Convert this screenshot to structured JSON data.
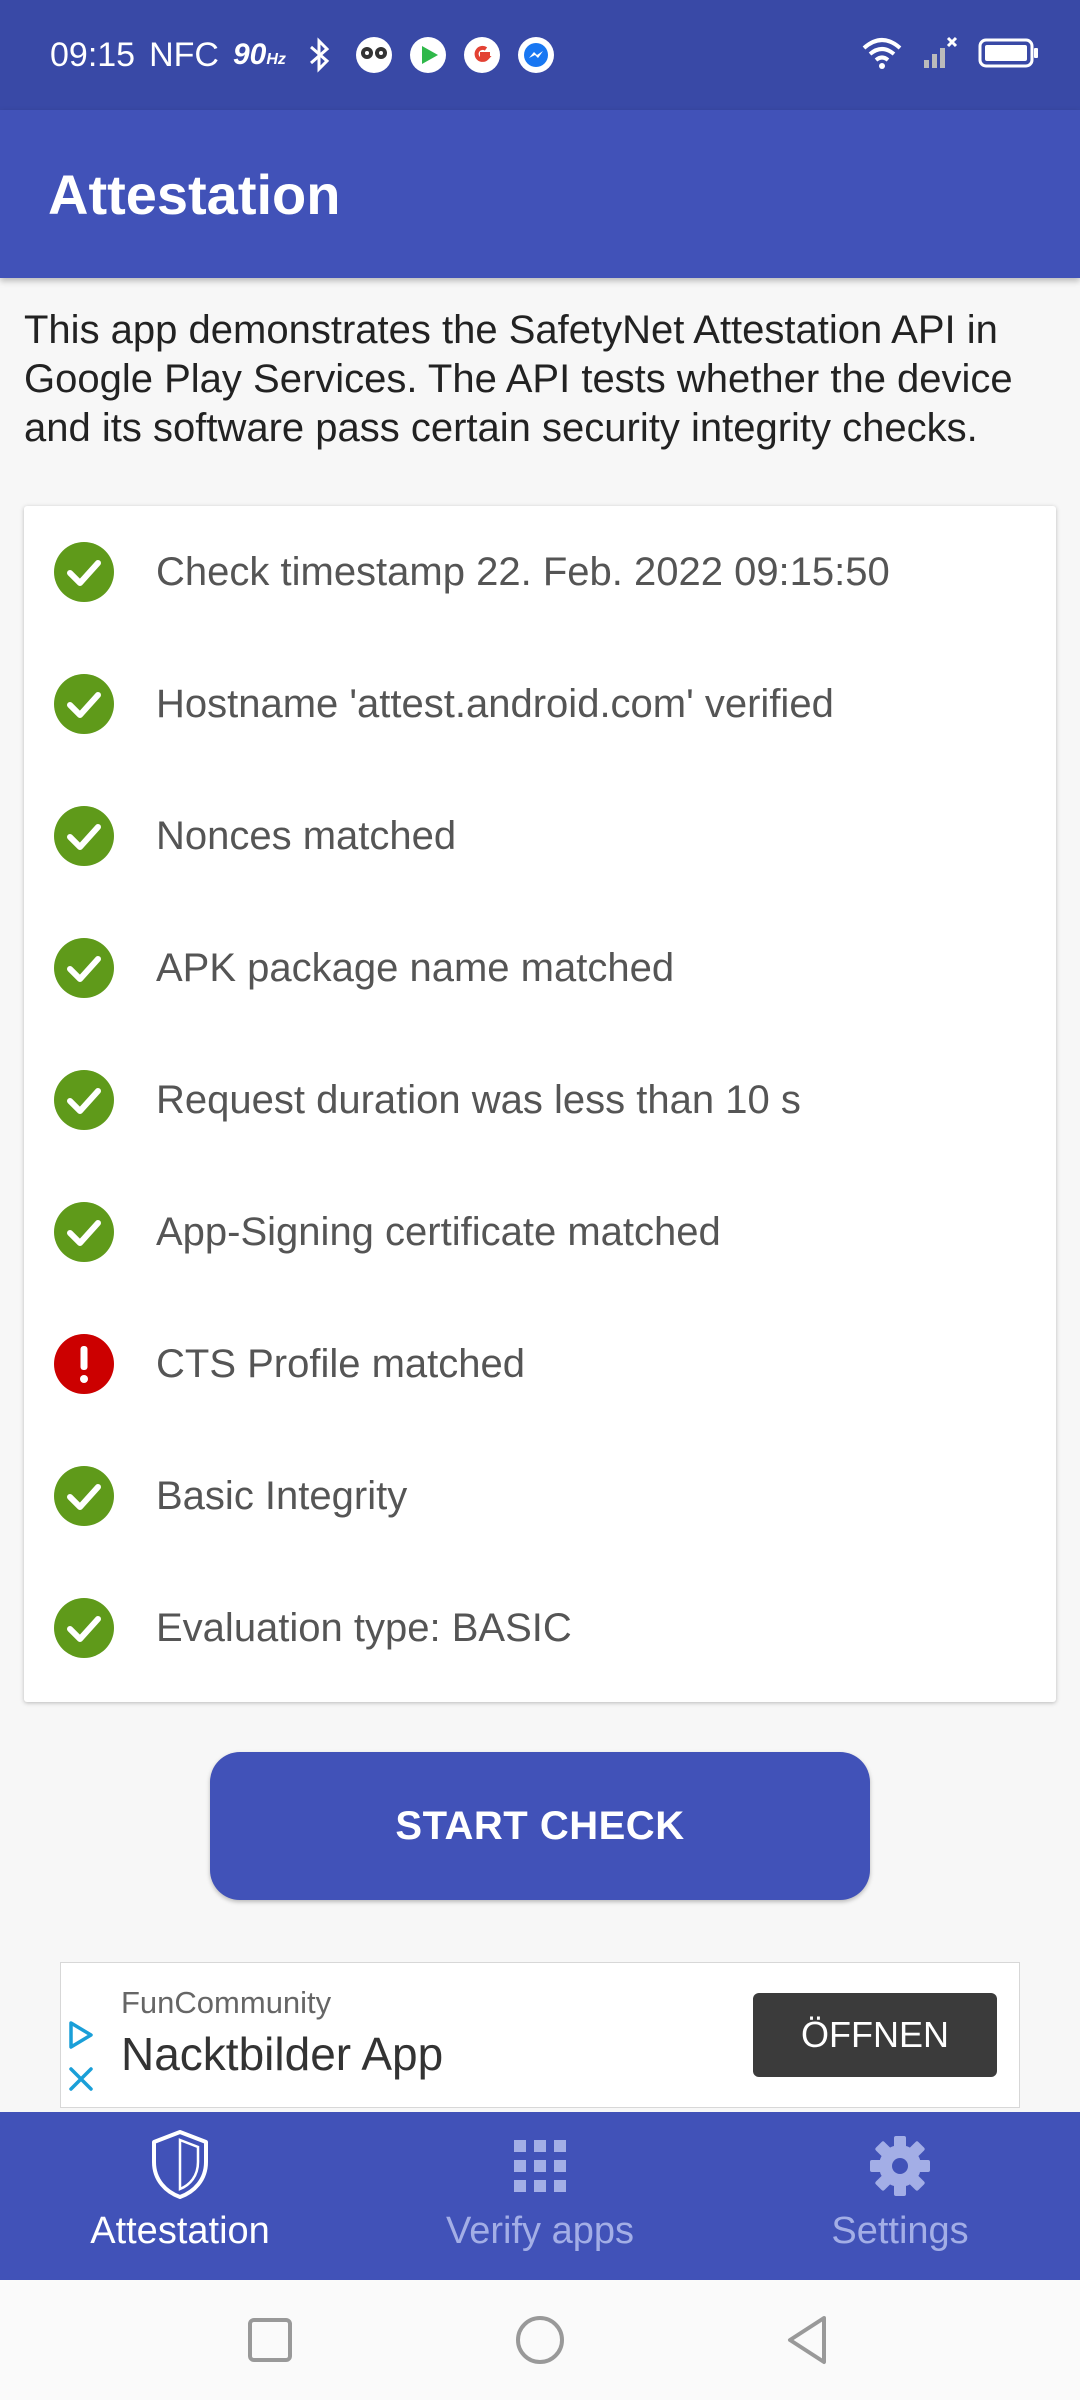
{
  "status_bar": {
    "time": "09:15",
    "nfc": "NFC",
    "refresh_rate": "90",
    "refresh_unit": "Hz",
    "icons": [
      "bluetooth-icon",
      "owl-app-icon",
      "play-store-icon",
      "google-icon",
      "messenger-icon",
      "wifi-icon",
      "signal-icon",
      "battery-icon"
    ]
  },
  "app_bar": {
    "title": "Attestation"
  },
  "intro": {
    "text": "This app demonstrates the SafetyNet Attestation API in Google Play Services. The API tests whether the device and its software pass certain security integrity checks."
  },
  "checks": [
    {
      "label": "Check timestamp 22. Feb. 2022 09:15:50",
      "status": "pass"
    },
    {
      "label": "Hostname 'attest.android.com' verified",
      "status": "pass"
    },
    {
      "label": "Nonces matched",
      "status": "pass"
    },
    {
      "label": "APK package name matched",
      "status": "pass"
    },
    {
      "label": "Request duration was less than 10 s",
      "status": "pass"
    },
    {
      "label": "App-Signing certificate matched",
      "status": "pass"
    },
    {
      "label": "CTS Profile matched",
      "status": "fail"
    },
    {
      "label": "Basic Integrity",
      "status": "pass"
    },
    {
      "label": "Evaluation type: BASIC",
      "status": "pass"
    }
  ],
  "start_button": {
    "label": "START CHECK"
  },
  "ad": {
    "advertiser": "FunCommunity",
    "headline": "Nacktbilder App",
    "open_label": "ÖFFNEN"
  },
  "bottom_nav": {
    "items": [
      {
        "label": "Attestation",
        "icon": "shield-icon",
        "active": true
      },
      {
        "label": "Verify apps",
        "icon": "apps-grid-icon",
        "active": false
      },
      {
        "label": "Settings",
        "icon": "gear-icon",
        "active": false
      }
    ]
  },
  "colors": {
    "primary": "#4152b8",
    "status_bar": "#3949a6",
    "pass": "#5f9a1a",
    "fail": "#cc0000"
  }
}
